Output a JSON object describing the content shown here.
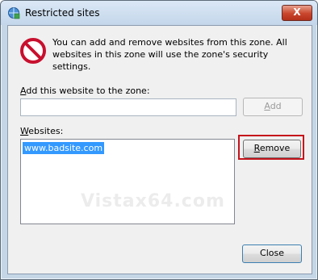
{
  "window": {
    "title": "Restricted sites",
    "close_glyph": "X"
  },
  "info": {
    "icon": "no-entry-icon",
    "text": "You can add and remove websites from this zone. All websites in this zone will use the zone's security settings."
  },
  "add_section": {
    "label_mnemonic": "A",
    "label_rest": "dd this website to the zone:",
    "input_value": "",
    "add_button_mnemonic": "A",
    "add_button_rest": "dd"
  },
  "websites_section": {
    "label_mnemonic": "W",
    "label_rest": "ebsites:",
    "items": [
      "www.badsite.com"
    ],
    "remove_button_mnemonic": "R",
    "remove_button_rest": "emove"
  },
  "footer": {
    "close_label": "Close"
  },
  "watermark": "Vistax64.com",
  "colors": {
    "highlight": "#c4131b",
    "selection": "#3399ff"
  }
}
